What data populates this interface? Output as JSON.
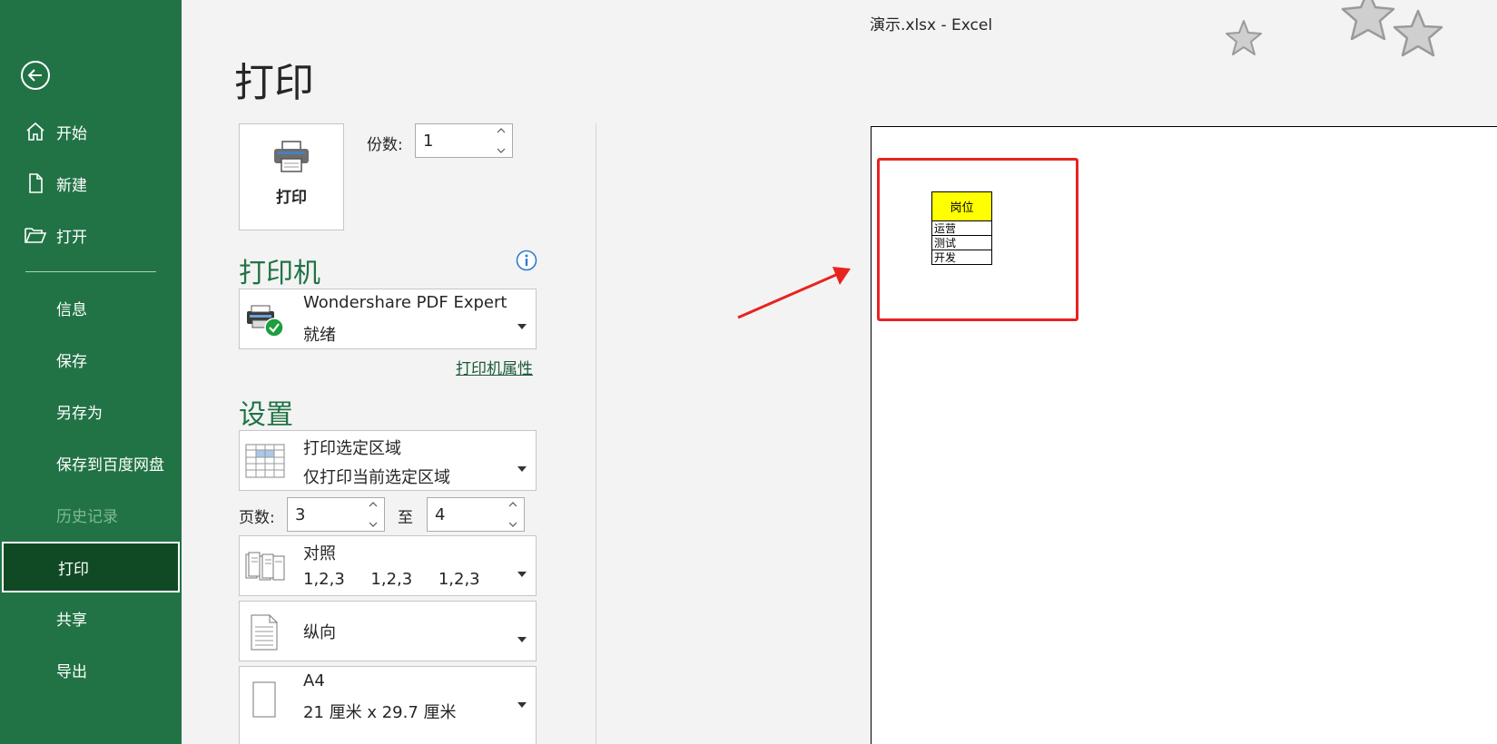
{
  "window": {
    "title": "演示.xlsx  -  Excel"
  },
  "sidebar": {
    "items": [
      {
        "label": "开始"
      },
      {
        "label": "新建"
      },
      {
        "label": "打开"
      },
      {
        "label": "信息"
      },
      {
        "label": "保存"
      },
      {
        "label": "另存为"
      },
      {
        "label": "保存到百度网盘"
      },
      {
        "label": "历史记录"
      },
      {
        "label": "打印"
      },
      {
        "label": "共享"
      },
      {
        "label": "导出"
      }
    ],
    "active": "打印"
  },
  "print": {
    "page_title": "打印",
    "button_label": "打印",
    "copies_label": "份数:",
    "copies_value": "1"
  },
  "printer": {
    "section_title": "打印机",
    "name": "Wondershare PDF Expert",
    "status": "就绪",
    "properties_link": "打印机属性"
  },
  "settings": {
    "section_title": "设置",
    "range": {
      "title": "打印选定区域",
      "subtitle": "仅打印当前选定区域"
    },
    "pages_label": "页数:",
    "pages_from": "3",
    "pages_to_label": "至",
    "pages_to": "4",
    "collate": {
      "title": "对照",
      "subtitle": "1,2,3     1,2,3     1,2,3"
    },
    "orientation": {
      "title": "纵向"
    },
    "paper": {
      "title": "A4",
      "subtitle": "21 厘米 x 29.7 厘米"
    }
  },
  "preview": {
    "table": {
      "header": "岗位",
      "rows": [
        "运营",
        "测试",
        "开发"
      ]
    }
  },
  "colors": {
    "brand_green": "#217346",
    "active_dark": "#0f4a24",
    "highlight_red": "#e8231f",
    "cell_yellow": "#ffff00"
  }
}
